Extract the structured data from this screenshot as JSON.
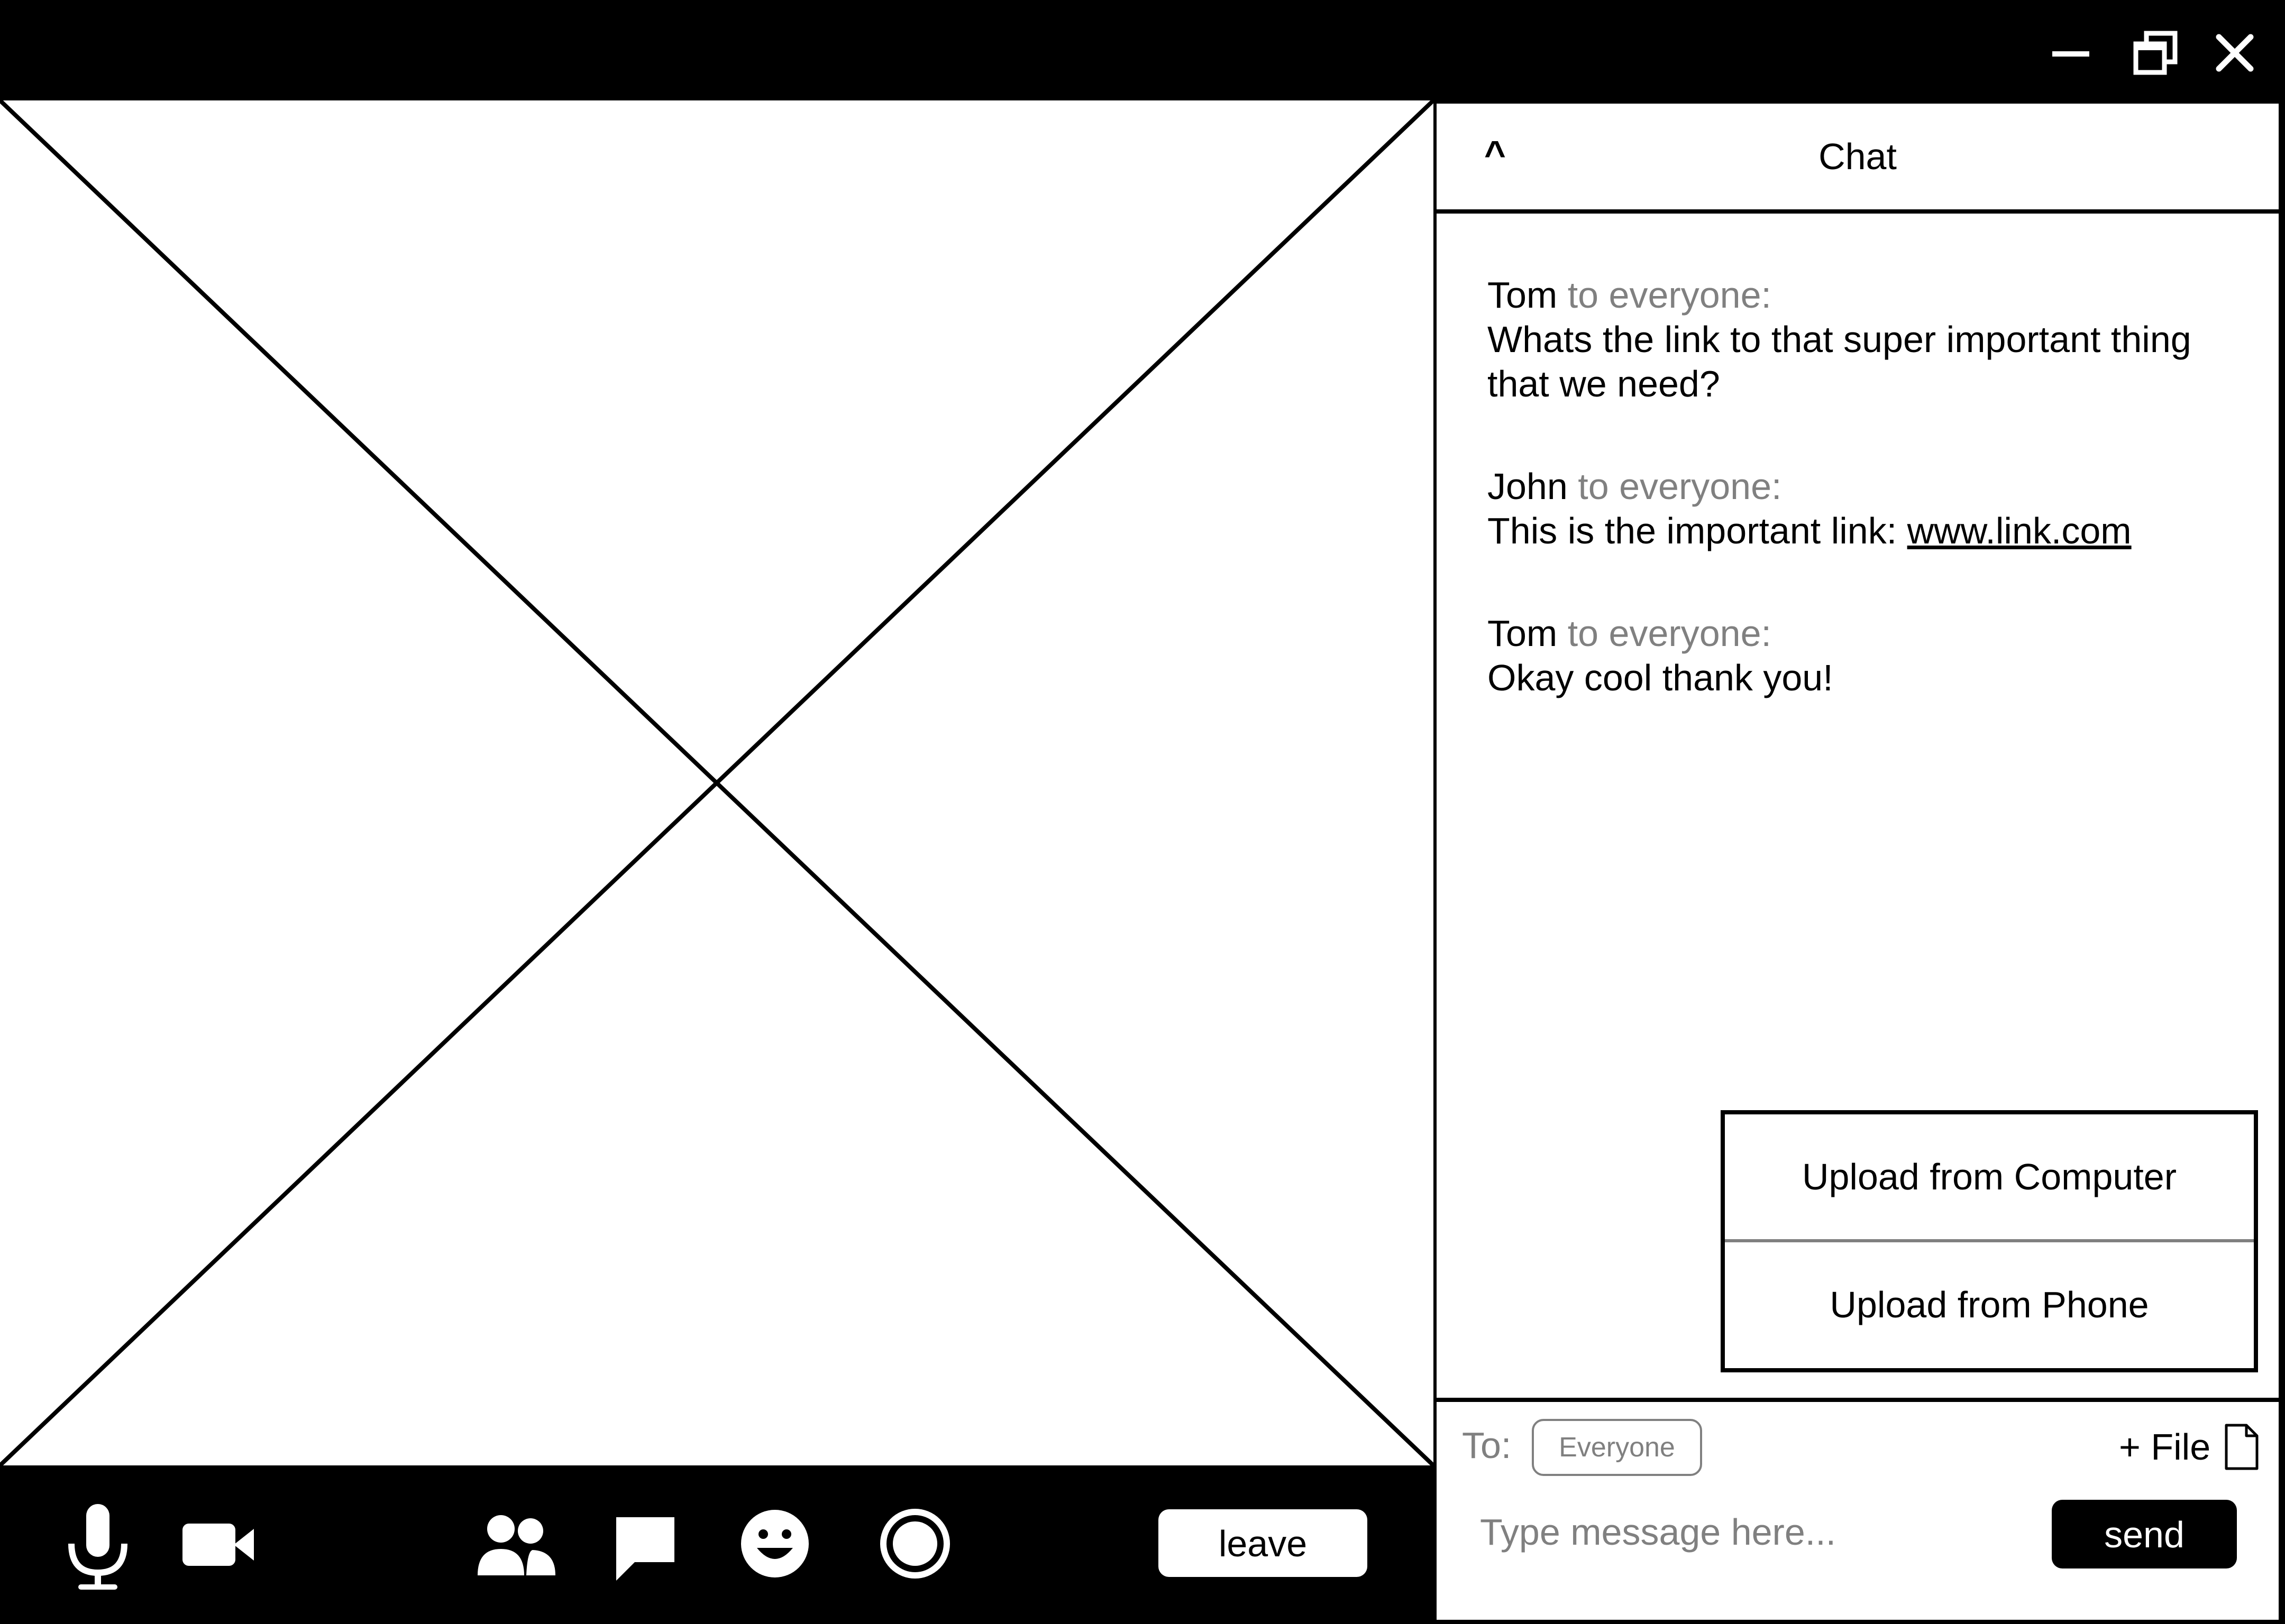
{
  "window": {
    "minimize_icon": "minimize-icon",
    "maximize_icon": "restore-icon",
    "close_icon": "close-icon"
  },
  "video": {
    "placeholder_icon": "image-placeholder-icon"
  },
  "toolbar": {
    "icons": [
      "microphone-icon",
      "camera-icon",
      "participants-icon",
      "chat-icon",
      "reactions-icon",
      "record-icon"
    ],
    "leave_label": "leave"
  },
  "chat": {
    "title": "Chat",
    "toggle": "^",
    "messages": [
      {
        "sender": "Tom",
        "audience": "to everyone:",
        "text": "Whats the link to that super important thing that we need?"
      },
      {
        "sender": "John",
        "audience": "to everyone:",
        "text": "This is the important link: ",
        "link": "www.link.com"
      },
      {
        "sender": "Tom",
        "audience": "to everyone:",
        "text": "Okay cool thank you!"
      }
    ],
    "upload_menu": {
      "computer": "Upload from Computer",
      "phone": "Upload from Phone"
    },
    "compose": {
      "to_label": "To:",
      "to_value": "Everyone",
      "file_label": "+ File",
      "placeholder": "Type message here...",
      "send_label": "send"
    }
  },
  "colors": {
    "bar": "#000000",
    "muted": "#808080",
    "background": "#ffffff"
  }
}
